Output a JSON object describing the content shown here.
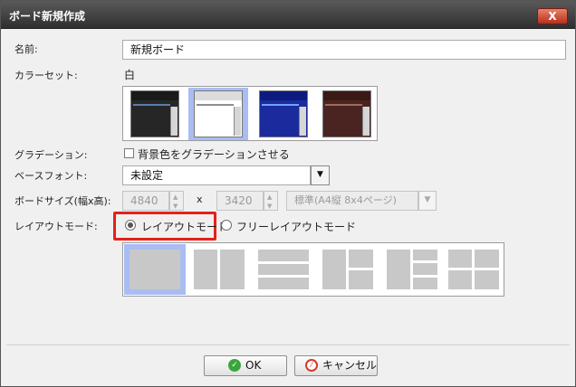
{
  "dialog": {
    "title": "ボード新規作成",
    "close_label": "X"
  },
  "form": {
    "name_label": "名前:",
    "name_value": "新規ボード",
    "colorset_label": "カラーセット:",
    "colorset_value": "白",
    "gradient_label": "グラデーション:",
    "gradient_checkbox_label": "背景色をグラデーションさせる",
    "gradient_checked": false,
    "font_label": "ベースフォント:",
    "font_value": "未設定",
    "size_label": "ボードサイズ(幅x高):",
    "width_value": "4840",
    "height_value": "3420",
    "times": "x",
    "size_preset": "標準(A4縦 8x4ページ)",
    "layout_label": "レイアウトモード:",
    "layout_mode_option": "レイアウトモード",
    "free_layout_option": "フリーレイアウトモード",
    "selected_layout_mode": "レイアウトモード"
  },
  "color_swatches": [
    {
      "name": "black",
      "bar": "#1a1a1a",
      "body": "#262626",
      "line": "#5a7fae"
    },
    {
      "name": "white",
      "bar": "#dcdcdc",
      "body": "#ffffff",
      "line": "#8e8e8e"
    },
    {
      "name": "blue",
      "bar": "#0d1b7e",
      "body": "#1b2a9c",
      "line": "#6fa3ff"
    },
    {
      "name": "brown",
      "bar": "#3a1a14",
      "body": "#4a2420",
      "line": "#a06a5a"
    }
  ],
  "selected_swatch": "white",
  "layout_templates": [
    "single",
    "two-columns",
    "three-rows",
    "mixed-right",
    "mixed-middle",
    "four-grid"
  ],
  "selected_template": "single",
  "buttons": {
    "ok_label": "OK",
    "cancel_label": "キャンセル"
  },
  "colors": {
    "highlight": "#e3221a",
    "selection": "#a9bdf2",
    "ok_icon": "#3aa63a",
    "cancel_icon": "#d23b2a"
  }
}
